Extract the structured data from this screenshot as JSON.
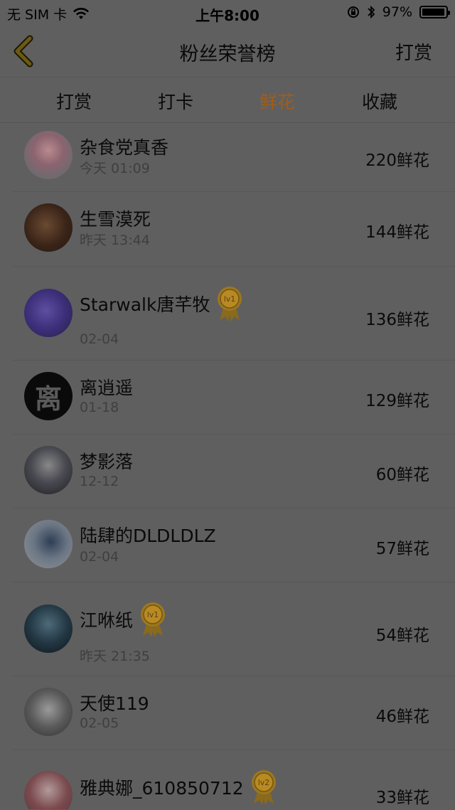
{
  "status_bar": {
    "carrier": "无 SIM 卡",
    "time": "上午8:00",
    "battery_percent": "97%",
    "battery_level": 0.97
  },
  "nav": {
    "title": "粉丝荣誉榜",
    "right_action": "打赏"
  },
  "tabs": [
    {
      "label": "打赏",
      "active": false
    },
    {
      "label": "打卡",
      "active": false
    },
    {
      "label": "鲜花",
      "active": true
    },
    {
      "label": "收藏",
      "active": false
    }
  ],
  "colors": {
    "active_tab": "#a35c16",
    "background_overlay": "#5f5f5f",
    "badge_gold": "#b98a24"
  },
  "rows": [
    {
      "name": "杂食党真香",
      "date": "今天 01:09",
      "amount": "220鲜花",
      "badge": ""
    },
    {
      "name": "生雪漠死",
      "date": "昨天 13:44",
      "amount": "144鲜花",
      "badge": ""
    },
    {
      "name": "Starwalk唐芊牧",
      "date": "02-04",
      "amount": "136鲜花",
      "badge": "lv1"
    },
    {
      "name": "离逍遥",
      "date": "01-18",
      "amount": "129鲜花",
      "badge": "",
      "avatar_text": "离"
    },
    {
      "name": "梦影落",
      "date": "12-12",
      "amount": "60鲜花",
      "badge": ""
    },
    {
      "name": "陆肆的DLDLDLZ",
      "date": "02-04",
      "amount": "57鲜花",
      "badge": ""
    },
    {
      "name": "江咻纸",
      "date": "昨天 21:35",
      "amount": "54鲜花",
      "badge": "lv1"
    },
    {
      "name": "天使119",
      "date": "02-05",
      "amount": "46鲜花",
      "badge": ""
    },
    {
      "name": "雅典娜_610850712",
      "date": "",
      "amount": "33鲜花",
      "badge": "lv2"
    }
  ]
}
